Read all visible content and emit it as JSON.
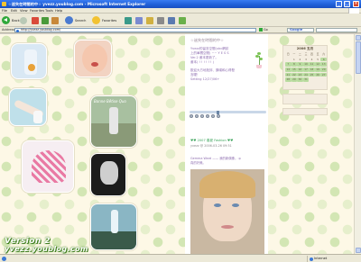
{
  "window": {
    "title": "☆迷失在時間的中☆ yvezz.youblog.com - Microsoft Internet Explorer",
    "controls": [
      "_",
      "□",
      "×"
    ]
  },
  "menu": {
    "items": [
      "File",
      "Edit",
      "View",
      "Favorites",
      "Tools",
      "Help"
    ]
  },
  "toolbar": {
    "back_label": "Back",
    "search_label": "Search",
    "favorites_label": "Favorites"
  },
  "address": {
    "label": "Address",
    "url": "http://yvezz.youblog.com/",
    "go_label": "Go",
    "google_label": "Google"
  },
  "blog": {
    "title": "☆迷失在時間的中☆",
    "intro_lines": [
      "Yvezz的留言空間(ubc網誌",
      "上的單獨空間) ~~ Y E S S",
      "Ver.2 畫本更新了。",
      "畫本( ! ! ! ! ! ! )",
      "",
      "歡迎大方地批評、讚嘆和心得發",
      "言喔！",
      "Setting 12/27/06+"
    ],
    "calendar_title": "2006 五月",
    "calendar_days": [
      "日",
      "一",
      "二",
      "三",
      "四",
      "五",
      "六",
      "",
      "1",
      "2",
      "3",
      "4",
      "5",
      "6",
      "7",
      "8",
      "9",
      "10",
      "11",
      "12",
      "13",
      "14",
      "15",
      "16",
      "17",
      "18",
      "19",
      "20",
      "21",
      "22",
      "23",
      "24",
      "25",
      "26",
      "27",
      "28",
      "29",
      "30",
      "31",
      "",
      "",
      ""
    ],
    "calendar_highlight": [
      "6",
      "7",
      "8",
      "9",
      "10",
      "11",
      "12",
      "13",
      "14",
      "15",
      "16",
      "17",
      "18",
      "19",
      "20",
      "21",
      "22",
      "23",
      "24",
      "25",
      "26",
      "27",
      "28",
      "29",
      "30",
      "31"
    ],
    "post_title": "♥♥ 2007 春夏 Fashion ♥♥",
    "post_meta": "yvezz @ 2006-03-26 09:51",
    "post_lines": [
      "Gemma Ward —— 我的新偶像。:p",
      "真的好美。"
    ],
    "photo_caption": "Bonne Bêtise Quo"
  },
  "signature": {
    "line1": "Version 2",
    "line2": "yvezz.youblog.com"
  },
  "status": {
    "zone": "Internet"
  },
  "colors": {
    "titlebar": "#1f5ed6",
    "page_bg": "#fdf8e6",
    "polka": "#d3e6b4",
    "accent_green": "#3aa35a",
    "text_purple": "#8f6fb0"
  }
}
